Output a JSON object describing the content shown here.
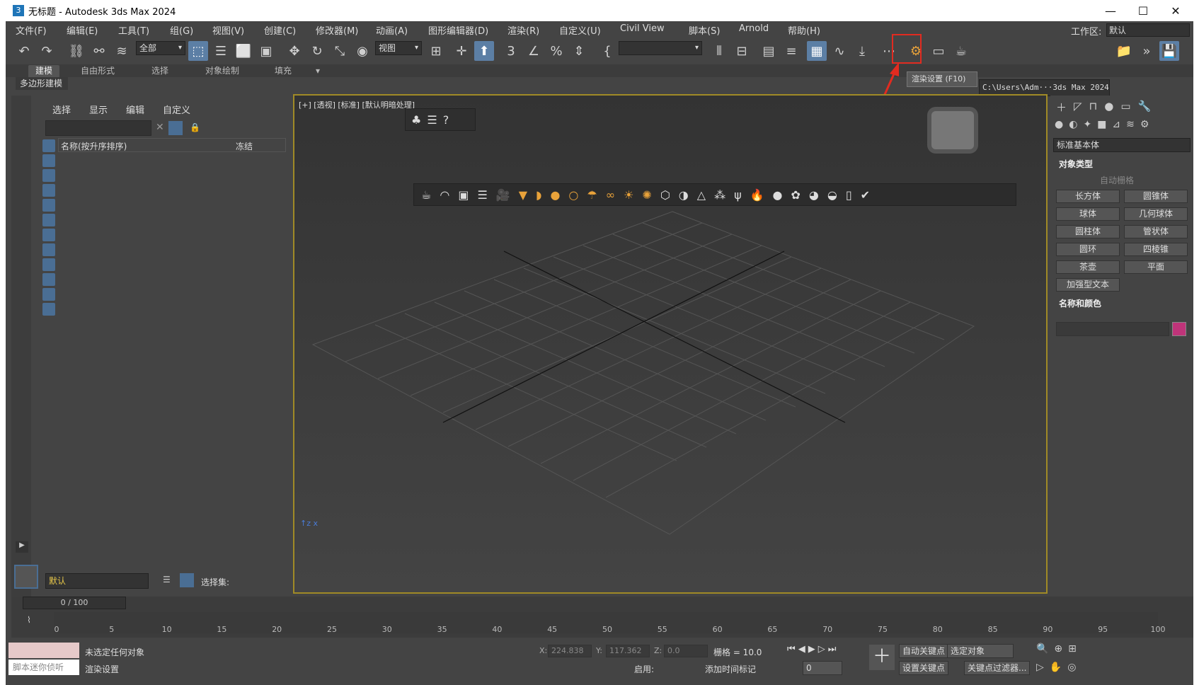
{
  "window": {
    "app_icon": "3",
    "title": "无标题 - Autodesk 3ds Max 2024",
    "minimize": "—",
    "maximize": "☐",
    "close": "✕"
  },
  "menu": [
    "文件(F)",
    "编辑(E)",
    "工具(T)",
    "组(G)",
    "视图(V)",
    "创建(C)",
    "修改器(M)",
    "动画(A)",
    "图形编辑器(D)",
    "渲染(R)",
    "自定义(U)",
    "Civil View",
    "脚本(S)",
    "Arnold",
    "帮助(H)"
  ],
  "workspace": {
    "label": "工作区:",
    "value": "默认"
  },
  "toolbar": {
    "selection_filter": "全部",
    "ref_coord": "视图",
    "path": "C:\\Users\\Adm···3ds Max 2024"
  },
  "ribbon": {
    "tabs": [
      "建模",
      "自由形式",
      "选择",
      "对象绘制",
      "填充"
    ],
    "sub": "多边形建模"
  },
  "tooltip": "渲染设置 (F10)",
  "scene_explorer": {
    "tabs": [
      "选择",
      "显示",
      "编辑",
      "自定义"
    ],
    "col_name": "名称(按升序排序)",
    "col_freeze": "冻结",
    "layer": "默认",
    "selection_set": "选择集:"
  },
  "viewport": {
    "label": "[+] [透视] [标准] [默认明暗处理]"
  },
  "command_panel": {
    "category": "标准基本体",
    "rollout_object_type": "对象类型",
    "auto_grid": "自动栅格",
    "buttons": [
      "长方体",
      "圆锥体",
      "球体",
      "几何球体",
      "圆柱体",
      "管状体",
      "圆环",
      "四棱锥",
      "茶壶",
      "平面",
      "加强型文本"
    ],
    "rollout_name_color": "名称和颜色",
    "color": "#c0347a"
  },
  "timeline": {
    "frame": "0 / 100",
    "ticks": [
      "0",
      "5",
      "10",
      "15",
      "20",
      "25",
      "30",
      "35",
      "40",
      "45",
      "50",
      "55",
      "60",
      "65",
      "70",
      "75",
      "80",
      "85",
      "90",
      "95",
      "100"
    ]
  },
  "status": {
    "maxscript_placeholder": "脚本迷你侦听",
    "line1": "未选定任何对象",
    "line2": "渲染设置",
    "x_label": "X:",
    "x": "224.838",
    "y_label": "Y:",
    "y": "117.362",
    "z_label": "Z:",
    "z": "0.0",
    "grid": "栅格 = 10.0",
    "enable": "启用:",
    "add_time_tag": "添加时间标记",
    "auto_key": "自动关键点",
    "set_key": "设置关键点",
    "selected": "选定对象",
    "key_filter": "关键点过滤器...",
    "frame_field": "0"
  }
}
